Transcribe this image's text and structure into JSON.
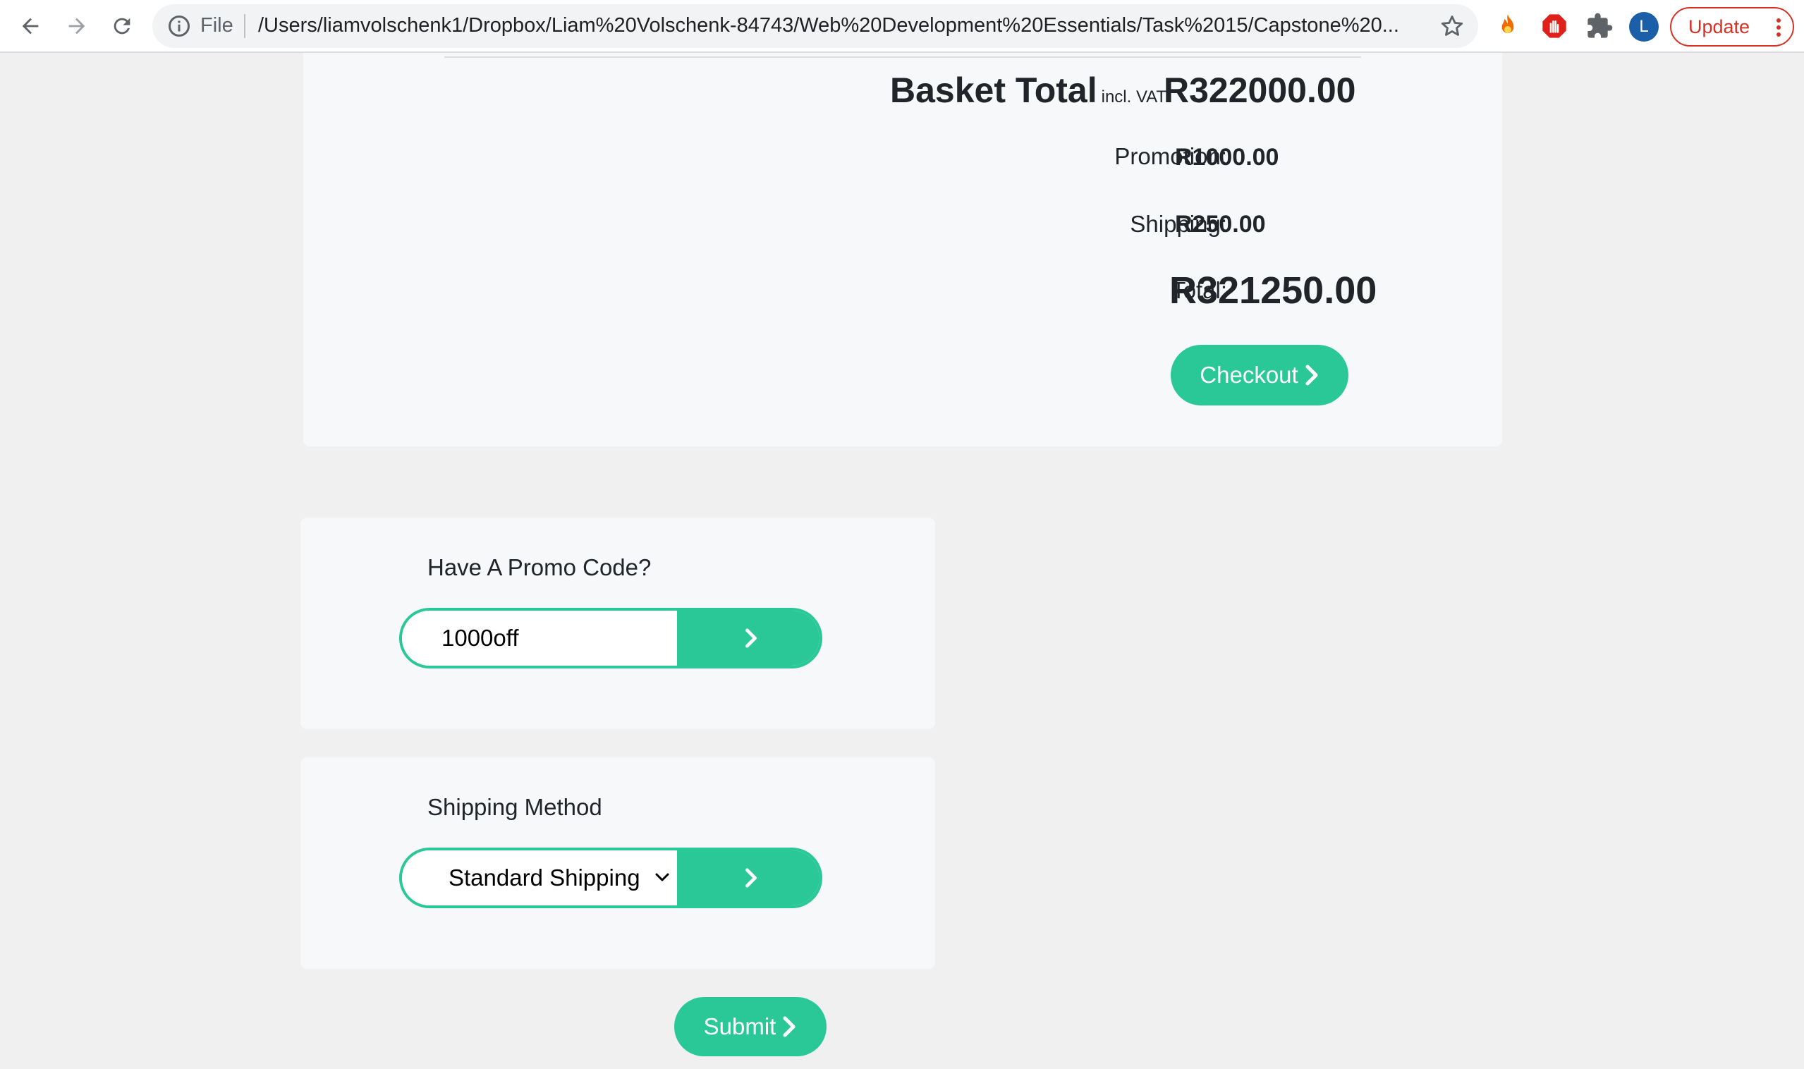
{
  "browser": {
    "protocol_label": "File",
    "url": "/Users/liamvolschenk1/Dropbox/Liam%20Volschenk-84743/Web%20Development%20Essentials/Task%2015/Capstone%20...",
    "avatar_letter": "L",
    "update_label": "Update",
    "icons": [
      "back-arrow-icon",
      "forward-arrow-icon",
      "reload-icon",
      "info-icon",
      "bookmark-star-icon",
      "flame-extension-icon",
      "stop-hand-extension-icon",
      "puzzle-extensions-icon",
      "kebab-menu-icon"
    ]
  },
  "basket": {
    "title": "Basket Total",
    "vat_note": "incl. VAT",
    "subtotal": "R322000.00",
    "promotion_label": "Promotion:",
    "promotion_value": "R1000.00",
    "shipping_label": "Shipping:",
    "shipping_value": "R250.00",
    "total_label": "Total:",
    "total_value": "R321250.00",
    "checkout_label": "Checkout"
  },
  "promo": {
    "title": "Have A Promo Code?",
    "code_value": "1000off"
  },
  "shipping_method": {
    "title": "Shipping Method",
    "selected": "Standard Shipping"
  },
  "submit_label": "Submit",
  "colors": {
    "accent": "#2ac896",
    "card_bg": "#f7f8fa",
    "page_bg": "#f0f0f0",
    "update_red": "#d93025"
  }
}
